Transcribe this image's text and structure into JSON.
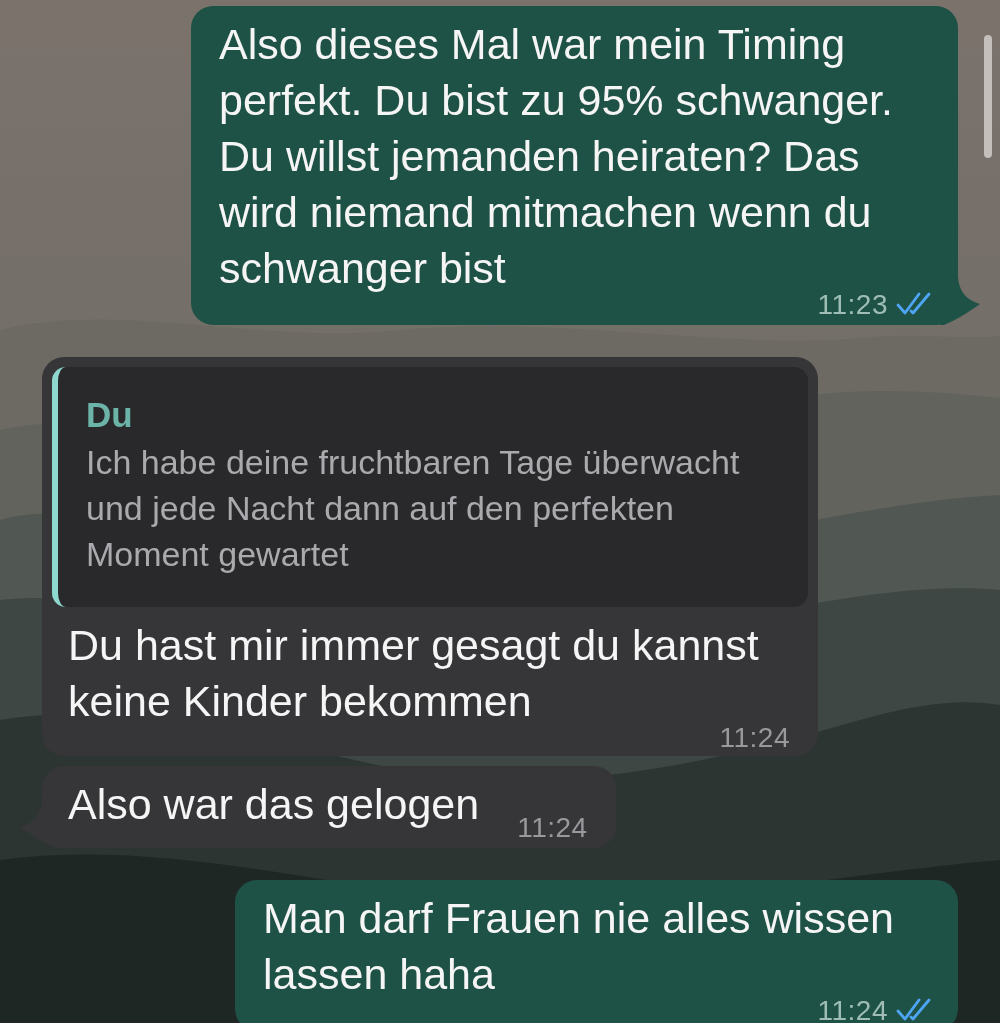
{
  "messages": [
    {
      "kind": "outgoing",
      "text": "Also dieses Mal war mein Timing perfekt. Du bist zu 95% schwanger. Du willst jemanden heiraten? Das wird niemand mitmachen wenn du schwanger bist",
      "time": "11:23",
      "read": true,
      "tail": true
    },
    {
      "kind": "incoming",
      "quote": {
        "sender": "Du",
        "text": "Ich habe deine fruchtbaren Tage überwacht und jede Nacht dann auf den perfekten Moment gewartet"
      },
      "text": "Du hast mir immer gesagt du kannst keine Kinder bekommen",
      "time": "11:24",
      "tail": false
    },
    {
      "kind": "incoming",
      "text": "Also war das gelogen",
      "time": "11:24",
      "tail": true
    },
    {
      "kind": "outgoing",
      "text": "Man darf Frauen nie alles wissen lassen haha",
      "time": "11:24",
      "read": true,
      "tail": false
    }
  ]
}
